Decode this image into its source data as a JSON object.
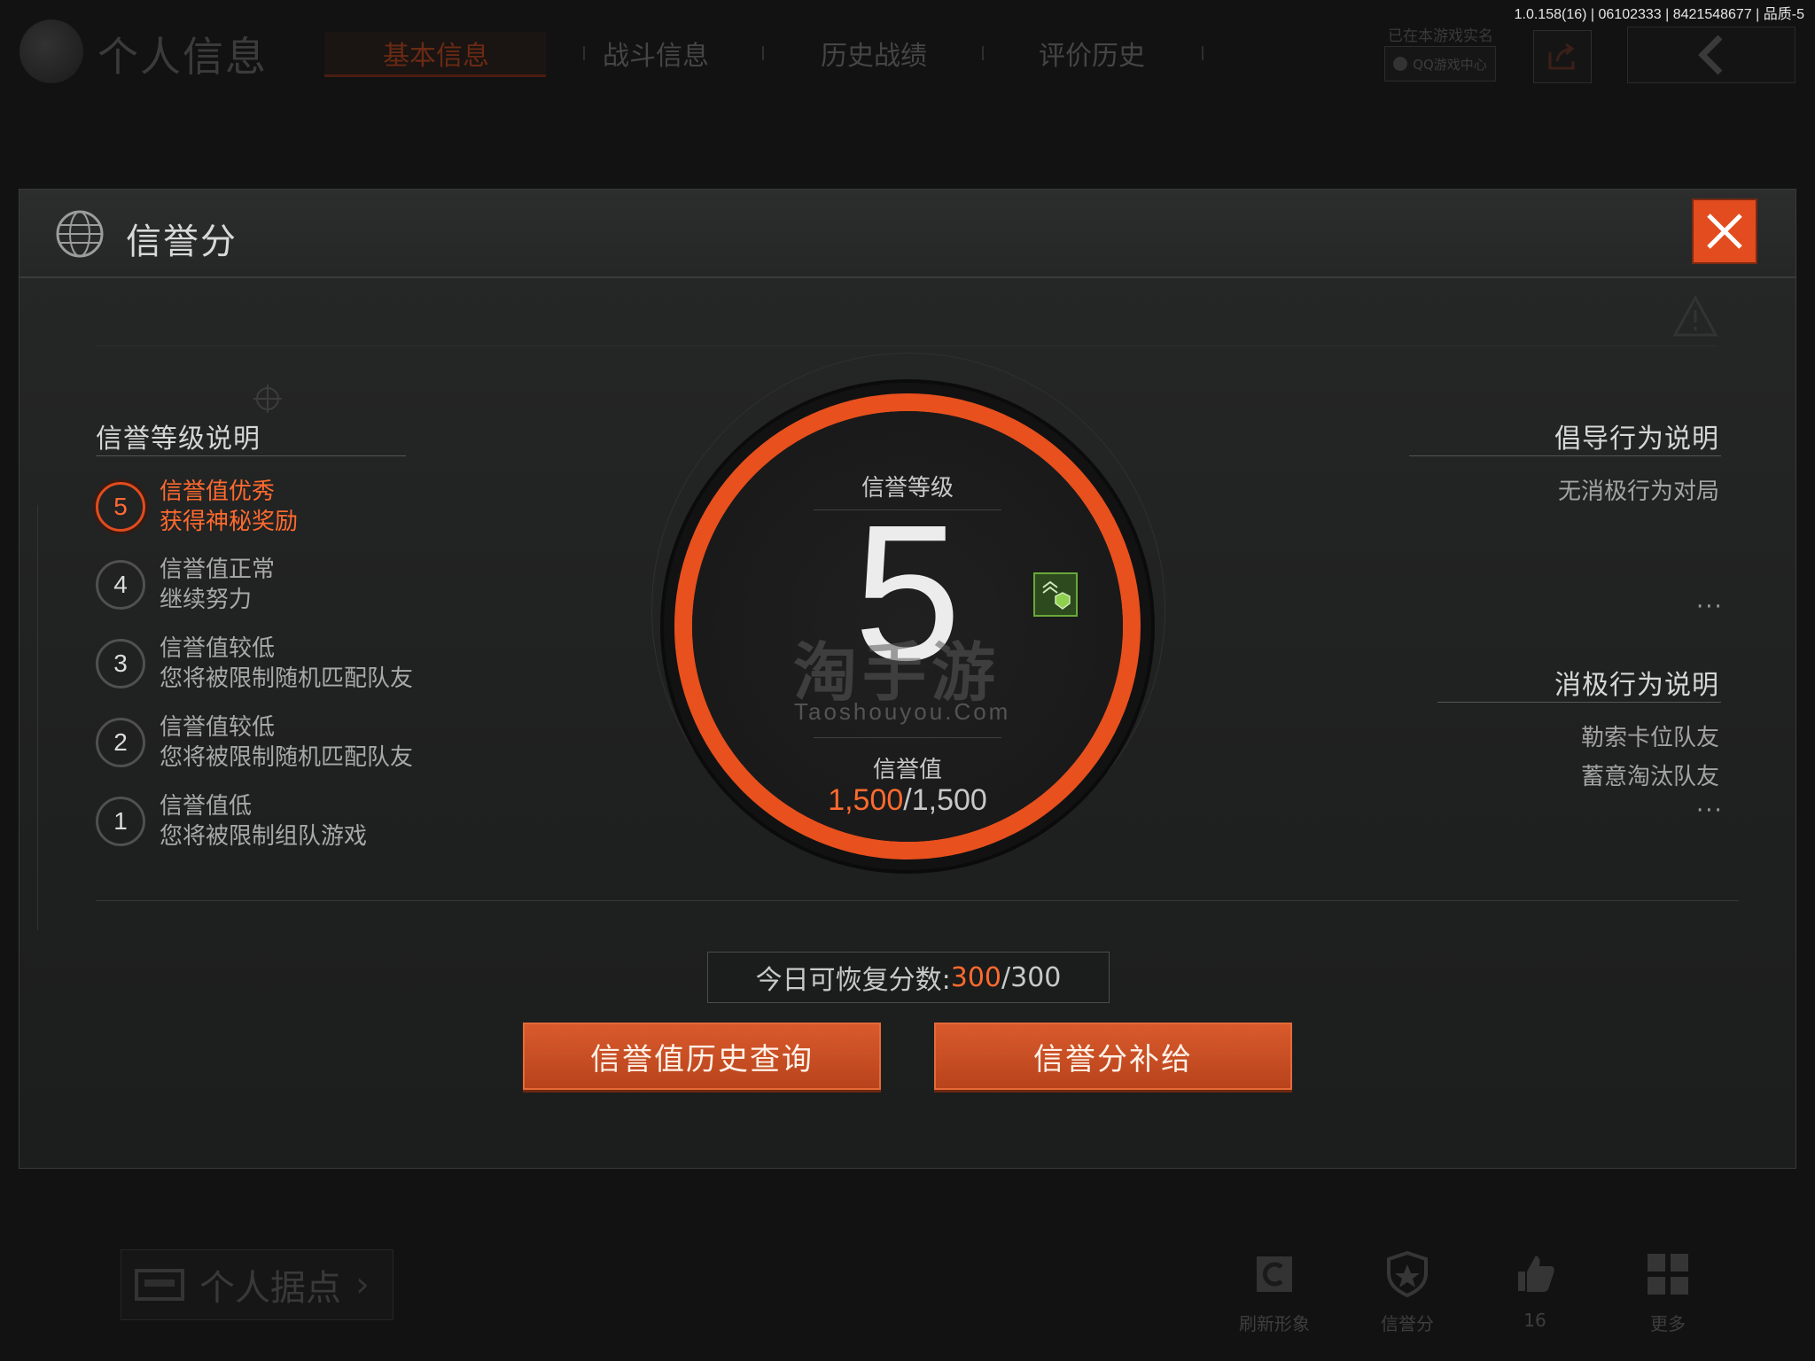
{
  "version_info": "1.0.158(16) | 06102333 | 8421548677 | 品质-5",
  "background": {
    "page_title": "个人信息",
    "tabs": [
      "基本信息",
      "战斗信息",
      "历史战绩",
      "评价历史"
    ],
    "realname_label": "已在本游戏实名",
    "qq_button": "QQ游戏中心",
    "base_button": "个人据点",
    "bottom_items": [
      "刷新形象",
      "信誉分",
      "16",
      "更多"
    ]
  },
  "modal": {
    "title": "信誉分",
    "left": {
      "title": "信誉等级说明",
      "levels": [
        {
          "num": "5",
          "line1": "信誉值优秀",
          "line2": "获得神秘奖励",
          "active": true
        },
        {
          "num": "4",
          "line1": "信誉值正常",
          "line2": "继续努力"
        },
        {
          "num": "3",
          "line1": "信誉值较低",
          "line2": "您将被限制随机匹配队友"
        },
        {
          "num": "2",
          "line1": "信誉值较低",
          "line2": "您将被限制随机匹配队友"
        },
        {
          "num": "1",
          "line1": "信誉值低",
          "line2": "您将被限制组队游戏"
        }
      ]
    },
    "right": {
      "advocate_title": "倡导行为说明",
      "advocate_items": [
        "无消极行为对局"
      ],
      "negative_title": "消极行为说明",
      "negative_items": [
        "勒索卡位队友",
        "蓄意淘汰队友"
      ],
      "more": "···"
    },
    "dial": {
      "level_label": "信誉等级",
      "level": "5",
      "score_label": "信誉值",
      "score_current": "1,500",
      "score_max": "/1,500",
      "watermark_cn": "淘手游",
      "watermark_en": "Taoshouyou.Com"
    },
    "recover": {
      "label": "今日可恢复分数:",
      "current": "300",
      "max": "/300"
    },
    "buttons": {
      "history": "信誉值历史查询",
      "supply": "信誉分补给"
    }
  },
  "colors": {
    "accent": "#e8501e",
    "accent_text": "#ff6a2e",
    "badge": "#6aa83a"
  }
}
